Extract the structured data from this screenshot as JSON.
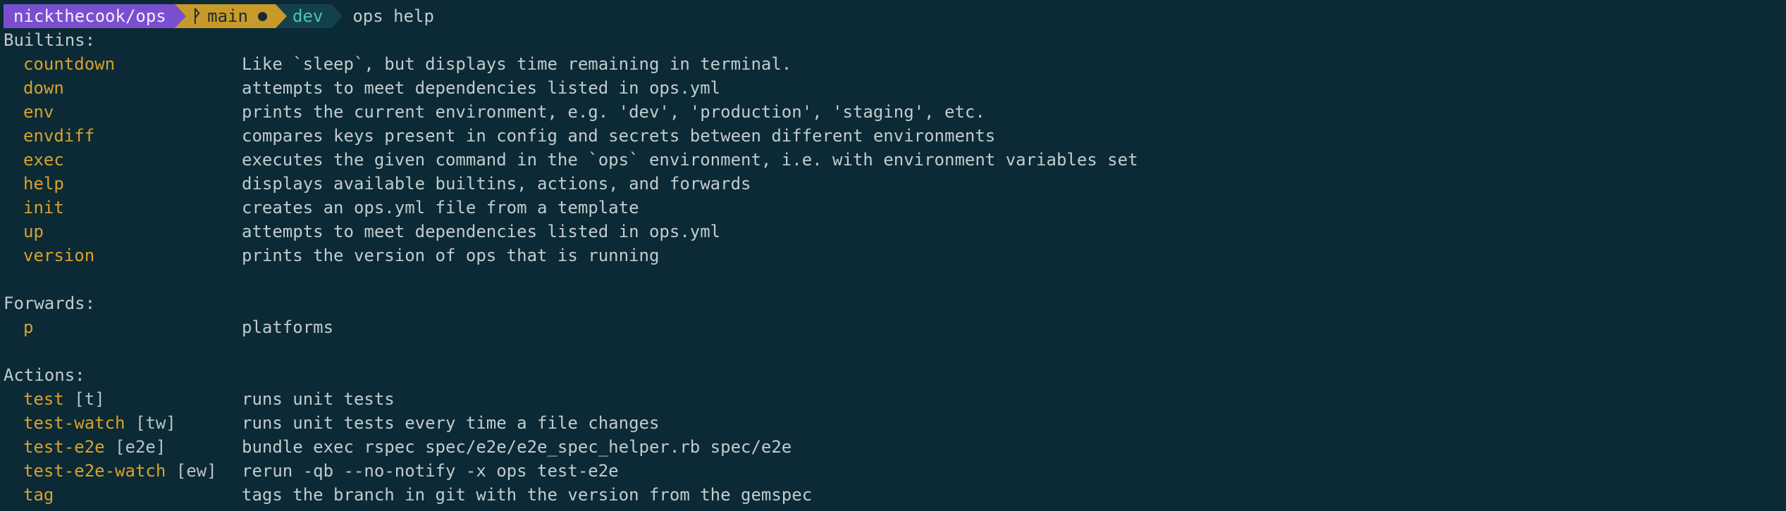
{
  "prompt": {
    "repo": "nickthecook/ops",
    "branch": "main",
    "env": "dev",
    "command": "ops help"
  },
  "sections": {
    "builtins": {
      "heading": "Builtins:",
      "items": [
        {
          "name": "countdown",
          "desc": "Like `sleep`, but displays time remaining in terminal."
        },
        {
          "name": "down",
          "desc": "attempts to meet dependencies listed in ops.yml"
        },
        {
          "name": "env",
          "desc": "prints the current environment, e.g. 'dev', 'production', 'staging', etc."
        },
        {
          "name": "envdiff",
          "desc": "compares keys present in config and secrets between different environments"
        },
        {
          "name": "exec",
          "desc": "executes the given command in the `ops` environment, i.e. with environment variables set"
        },
        {
          "name": "help",
          "desc": "displays available builtins, actions, and forwards"
        },
        {
          "name": "init",
          "desc": "creates an ops.yml file from a template"
        },
        {
          "name": "up",
          "desc": "attempts to meet dependencies listed in ops.yml"
        },
        {
          "name": "version",
          "desc": "prints the version of ops that is running"
        }
      ]
    },
    "forwards": {
      "heading": "Forwards:",
      "items": [
        {
          "name": "p",
          "desc": "platforms"
        }
      ]
    },
    "actions": {
      "heading": "Actions:",
      "items": [
        {
          "name": "test",
          "alias": "[t]",
          "desc": "runs unit tests"
        },
        {
          "name": "test-watch",
          "alias": "[tw]",
          "desc": "runs unit tests every time a file changes"
        },
        {
          "name": "test-e2e",
          "alias": "[e2e]",
          "desc": "bundle exec rspec spec/e2e/e2e_spec_helper.rb spec/e2e"
        },
        {
          "name": "test-e2e-watch",
          "alias": "[ew]",
          "desc": "rerun -qb --no-notify -x ops test-e2e"
        },
        {
          "name": "tag",
          "alias": "",
          "desc": "tags the branch in git with the version from the gemspec"
        }
      ]
    }
  },
  "icons": {
    "branch": "git-branch-icon",
    "dirty": "dirty-dot-icon"
  },
  "colors": {
    "background": "#0b2a35",
    "text": "#c3cbcd",
    "command_name": "#d9a12c",
    "repo_segment": "#7a4fcf",
    "branch_segment": "#c79a2a",
    "env_segment": "#12414c",
    "env_text": "#4fc1b4"
  }
}
